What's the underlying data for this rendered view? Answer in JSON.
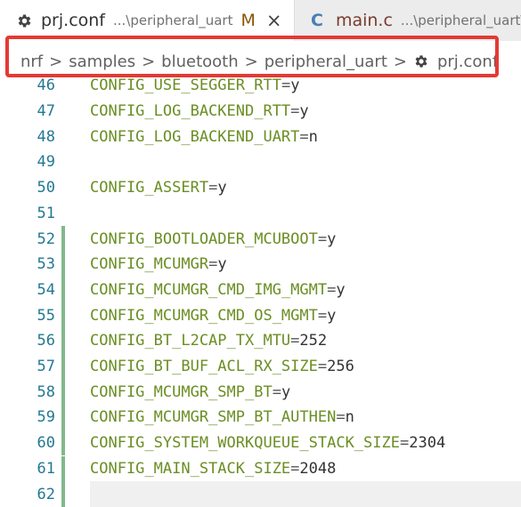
{
  "tabs": [
    {
      "name": "prj.conf",
      "path": "...\\peripheral_uart",
      "modified": "M",
      "close": "×",
      "icon": "gear-icon"
    },
    {
      "name": "main.c",
      "path": "...\\peripheral_uart\\",
      "icon_letter": "C"
    }
  ],
  "breadcrumb": {
    "items": [
      "nrf",
      "samples",
      "bluetooth",
      "peripheral_uart",
      "prj.conf"
    ],
    "separator": ">"
  },
  "colors": {
    "highlight_box": "#e53935",
    "gutter_added": "#81b88b",
    "line_number": "#237893",
    "code_key": "#6b8e23"
  },
  "editor": {
    "lines": [
      {
        "num": "46",
        "key": "CONFIG_USE_SEGGER_RTT",
        "val": "y",
        "added": false
      },
      {
        "num": "47",
        "key": "CONFIG_LOG_BACKEND_RTT",
        "val": "y",
        "added": false
      },
      {
        "num": "48",
        "key": "CONFIG_LOG_BACKEND_UART",
        "val": "n",
        "added": false
      },
      {
        "num": "49",
        "key": "",
        "val": "",
        "added": false
      },
      {
        "num": "50",
        "key": "CONFIG_ASSERT",
        "val": "y",
        "added": false
      },
      {
        "num": "51",
        "key": "",
        "val": "",
        "added": false
      },
      {
        "num": "52",
        "key": "CONFIG_BOOTLOADER_MCUBOOT",
        "val": "y",
        "added": true
      },
      {
        "num": "53",
        "key": "CONFIG_MCUMGR",
        "val": "y",
        "added": true
      },
      {
        "num": "54",
        "key": "CONFIG_MCUMGR_CMD_IMG_MGMT",
        "val": "y",
        "added": true
      },
      {
        "num": "55",
        "key": "CONFIG_MCUMGR_CMD_OS_MGMT",
        "val": "y",
        "added": true
      },
      {
        "num": "56",
        "key": "CONFIG_BT_L2CAP_TX_MTU",
        "val": "252",
        "added": true
      },
      {
        "num": "57",
        "key": "CONFIG_BT_BUF_ACL_RX_SIZE",
        "val": "256",
        "added": true
      },
      {
        "num": "58",
        "key": "CONFIG_MCUMGR_SMP_BT",
        "val": "y",
        "added": true
      },
      {
        "num": "59",
        "key": "CONFIG_MCUMGR_SMP_BT_AUTHEN",
        "val": "n",
        "added": true
      },
      {
        "num": "60",
        "key": "CONFIG_SYSTEM_WORKQUEUE_STACK_SIZE",
        "val": "2304",
        "added": true
      },
      {
        "num": "61",
        "key": "CONFIG_MAIN_STACK_SIZE",
        "val": "2048",
        "added": true
      },
      {
        "num": "62",
        "key": "",
        "val": "",
        "added": true,
        "current": true
      }
    ]
  }
}
